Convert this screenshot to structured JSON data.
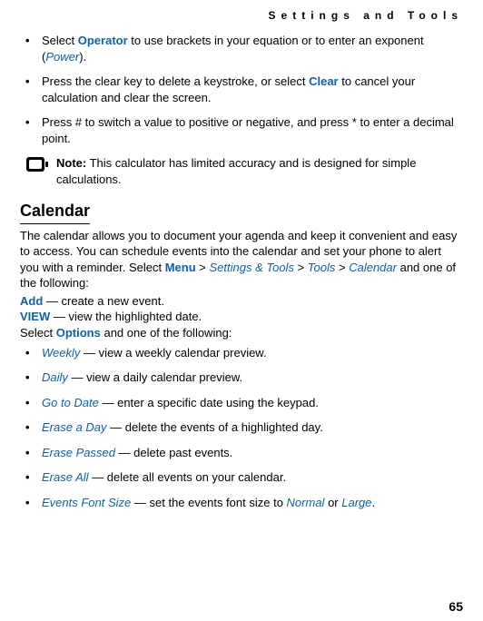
{
  "header": {
    "running": "Settings and Tools"
  },
  "bullets_top": [
    {
      "pre": "Select ",
      "hl": "Operator",
      "mid": " to use brackets in your equation or to enter an exponent (",
      "hl2": "Power",
      "post": ")."
    },
    {
      "pre": "Press the clear key to delete a keystroke, or select ",
      "hl": "Clear",
      "mid": " to cancel your calculation and clear the screen.",
      "hl2": "",
      "post": ""
    },
    {
      "pre": "Press # to switch a value to positive or negative, and press * to enter a decimal point.",
      "hl": "",
      "mid": "",
      "hl2": "",
      "post": ""
    }
  ],
  "note": {
    "label": "Note:",
    "text": " This calculator has limited accuracy and is designed for simple calculations."
  },
  "section": {
    "title": "Calendar"
  },
  "calendar_intro": {
    "pre": "The calendar allows you to document your agenda and keep it convenient and easy to access. You can schedule events into the calendar and set your phone to alert you with a reminder. Select ",
    "menu": "Menu",
    "gt1": " > ",
    "st": "Settings & Tools",
    "gt2": " > ",
    "tools": "Tools",
    "gt3": " > ",
    "cal": "Calendar",
    "post": " and one of the following:"
  },
  "lines": {
    "add_label": "Add",
    "add_text": " — create a new event.",
    "view_label": "VIEW",
    "view_text": " — view the highlighted date.",
    "select": "Select ",
    "options": "Options",
    "select_post": " and one of the following:"
  },
  "options": [
    {
      "name": "Weekly",
      "desc": " — view a weekly calendar preview."
    },
    {
      "name": "Daily",
      "desc": " — view a daily calendar preview."
    },
    {
      "name": "Go to Date",
      "desc": "  — enter a specific date using the keypad."
    },
    {
      "name": "Erase a Day",
      "desc": " — delete the events of a highlighted day."
    },
    {
      "name": "Erase Passed",
      "desc": " — delete past events."
    },
    {
      "name": "Erase All",
      "desc": " — delete all events on your calendar."
    }
  ],
  "option_last": {
    "name": "Events Font Size",
    "desc1": " — set the events font size to ",
    "v1": "Normal",
    "or": " or ",
    "v2": "Large",
    "end": "."
  },
  "footer": {
    "page": "65"
  }
}
